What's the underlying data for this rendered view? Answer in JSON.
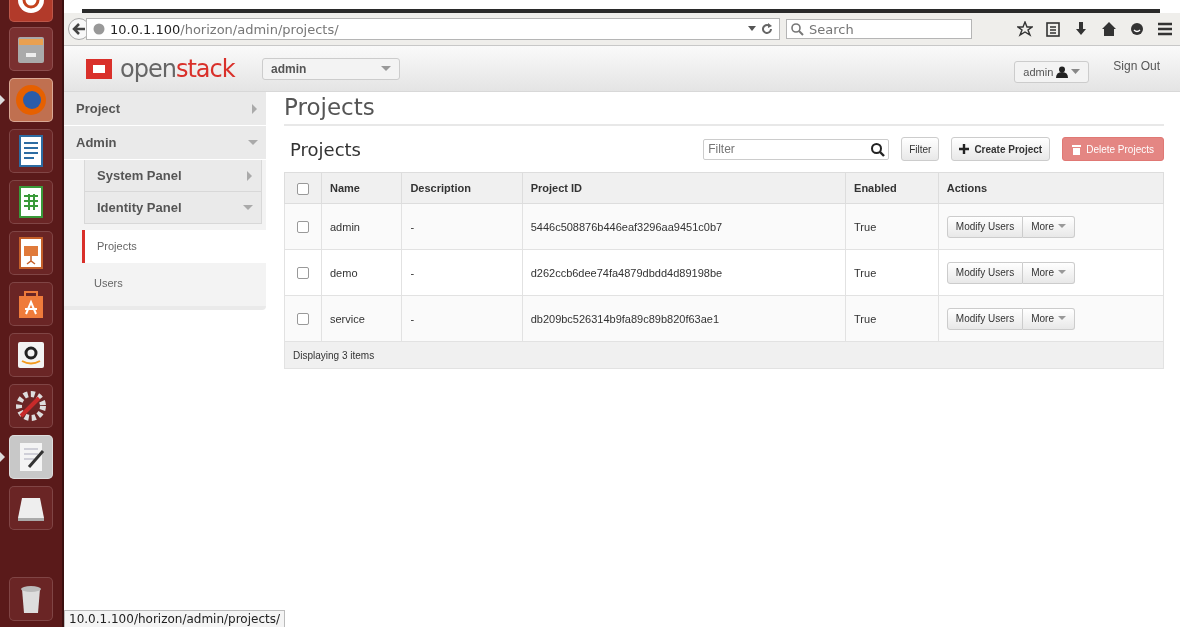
{
  "launcher": {
    "items": [
      {
        "kind": "ubuntu",
        "active": false
      },
      {
        "kind": "files",
        "active": false
      },
      {
        "kind": "firefox",
        "active": true
      },
      {
        "kind": "writer",
        "active": false
      },
      {
        "kind": "calc",
        "active": false
      },
      {
        "kind": "impress",
        "active": false
      },
      {
        "kind": "store",
        "active": false
      },
      {
        "kind": "amazon",
        "active": false
      },
      {
        "kind": "settings",
        "active": false
      },
      {
        "kind": "editor",
        "active": true
      },
      {
        "kind": "drive",
        "active": false
      },
      {
        "kind": "trash",
        "active": false
      }
    ]
  },
  "browser": {
    "url_host": "10.0.1.100",
    "url_path": "/horizon/admin/projects/",
    "search_placeholder": "Search"
  },
  "header": {
    "logo": [
      "open",
      "stack"
    ],
    "project_selector": "admin",
    "user_menu": "admin",
    "sign_out": "Sign Out"
  },
  "sidebar": {
    "items": [
      {
        "label": "Project",
        "expanded": false
      },
      {
        "label": "Admin",
        "expanded": true,
        "children": [
          {
            "label": "System Panel",
            "expanded": false
          },
          {
            "label": "Identity Panel",
            "expanded": true,
            "children": [
              {
                "label": "Projects",
                "selected": true
              },
              {
                "label": "Users",
                "selected": false
              }
            ]
          }
        ]
      }
    ]
  },
  "page_title": "Projects",
  "table": {
    "title": "Projects",
    "filter_placeholder": "Filter",
    "filter_button": "Filter",
    "create_button": "Create Project",
    "delete_button": {
      "label": "Delete Projects",
      "disabled": true
    },
    "header_checked": false,
    "columns": [
      "Name",
      "Description",
      "Project ID",
      "Enabled",
      "Actions"
    ],
    "rows": [
      {
        "checked": false,
        "cells": [
          "admin",
          "-",
          "5446c508876b446eaf3296aa9451c0b7",
          "True"
        ],
        "actions": [
          "Modify Users",
          "More"
        ]
      },
      {
        "checked": false,
        "cells": [
          "demo",
          "-",
          "d262ccb6dee74fa4879dbdd4d89198be",
          "True"
        ],
        "actions": [
          "Modify Users",
          "More"
        ]
      },
      {
        "checked": false,
        "cells": [
          "service",
          "-",
          "db209bc526314b9fa89c89b820f63ae1",
          "True"
        ],
        "actions": [
          "Modify Users",
          "More"
        ]
      }
    ],
    "footer": "Displaying 3 items"
  },
  "status_url": "10.0.1.100/horizon/admin/projects/"
}
